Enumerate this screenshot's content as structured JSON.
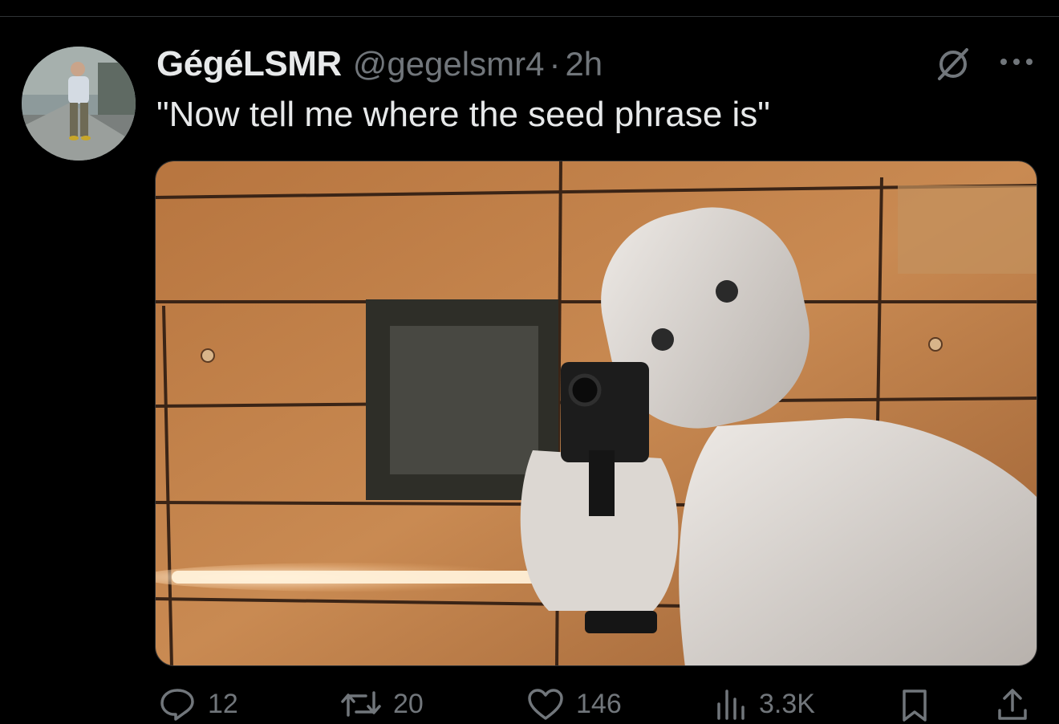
{
  "tweet": {
    "display_name": "GégéLSMR",
    "handle": "@gegelsmr4",
    "separator": "·",
    "time": "2h",
    "text": "\"Now tell me where the seed phrase is\""
  },
  "header_icons": [
    "grok-icon",
    "more-options-icon"
  ],
  "actions": {
    "replies": "12",
    "reposts": "20",
    "likes": "146",
    "views": "3.3K"
  },
  "colors": {
    "background": "#000000",
    "text_primary": "#e7e9ea",
    "text_secondary": "#71767b",
    "divider": "#2f3336"
  }
}
